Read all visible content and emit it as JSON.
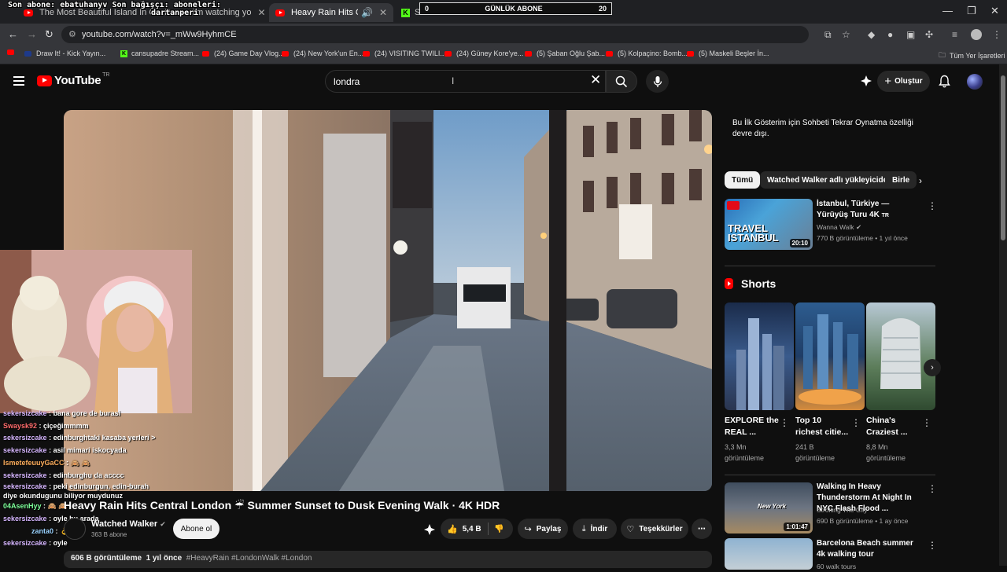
{
  "overlay": {
    "line1": "Son abone: ebatuhanyv Son bağışçı: aboneleri:",
    "line2": "dartanperi",
    "abone_left": "0",
    "abone_label": "GÜNLÜK ABONE",
    "abone_count": "20"
  },
  "tabs": [
    {
      "label": "The Most Beautiful Island In On"
    },
    {
      "label": "...Rosa - i'm watching yo"
    },
    {
      "label": "Heavy Rain Hits Central Lon"
    },
    {
      "label": "Stream - Kick Dashboard"
    }
  ],
  "browser": {
    "url": "youtube.com/watch?v=_mWw9HyhmCE",
    "bookmarks": [
      "Draw It! - Kick Yayın...",
      "cansupadre Stream...",
      "(24) Game Day Vlog...",
      "(24) New York'un En...",
      "(24) VISITING TWILI...",
      "(24) Güney Kore'ye...",
      "(5) Şaban Oğlu Şab...",
      "(5) Kolpaçino: Bomb...",
      "(5) Maskeli Beşler İn..."
    ],
    "all_bookmarks": "Tüm Yer İşaretleri"
  },
  "header": {
    "logo": "YouTube",
    "country": "TR",
    "search_value": "londra",
    "create_label": "Oluştur"
  },
  "video": {
    "title": "Heavy Rain Hits Central London ☔ Summer Sunset to Dusk Evening Walk · 4K HDR",
    "channel": "Watched Walker",
    "subs": "363 B abone",
    "subscribe": "Abone ol",
    "likes": "5,4 B",
    "share": "Paylaş",
    "download": "İndir",
    "thanks": "Teşekkürler",
    "views": "606 B görüntüleme",
    "age": "1 yıl önce",
    "tags": "#HeavyRain #LondonWalk #London"
  },
  "chat": [
    {
      "user": "sekersizcake",
      "msg": "bana gore de burasi"
    },
    {
      "user": "Swaysk92",
      "msg": "çiçeğimmmm"
    },
    {
      "user": "sekersizcake",
      "msg": "edinburghtaki kasaba yerleri >"
    },
    {
      "user": "sekersizcake",
      "msg": "asil mimari iskocyada"
    },
    {
      "user": "IsmetefeuuyGaCC",
      "msg": "🙈 🙈"
    },
    {
      "user": "sekersizcake",
      "msg": "edinburghu da acccc"
    },
    {
      "user": "sekersizcake",
      "msg": "peki edinburgun, edin-burah diye okundugunu biliyor muydunuz"
    },
    {
      "user": "04AsenHyy",
      "msg": "🙈 🙈"
    },
    {
      "user": "sekersizcake",
      "msg": "oyle bu arada"
    },
    {
      "user": "zanta0",
      "msg": "👌"
    },
    {
      "user": "sekersizcake",
      "msg": "oyle"
    }
  ],
  "sidebar": {
    "notice": "Bu İlk Gösterim için Sohbeti Tekrar Oynatma özelliği devre dışı.",
    "chips": [
      "Tümü",
      "Watched Walker adlı yükleyiciden",
      "Birle"
    ],
    "rec1": {
      "title": "İstanbul, Türkiye — Yürüyüş Turu 4K",
      "country": "TR",
      "channel": "Wanna Walk",
      "meta": "770 B görüntüleme • 1 yıl önce",
      "duration": "20:10",
      "thumb_text1": "TRAVEL",
      "thumb_text2": "ISTANBUL"
    },
    "shorts_label": "Shorts",
    "shorts": [
      {
        "title": "EXPLORE the REAL ...",
        "views": "3,3 Mn görüntüleme"
      },
      {
        "title": "Top 10 richest citie...",
        "views": "241 B görüntüleme"
      },
      {
        "title": "China's Craziest ...",
        "views": "8,8 Mn görüntüleme"
      }
    ],
    "rec2": {
      "title": "Walking In Heavy Thunderstorm At Night In NYC Flash Flood ...",
      "channel": "Strolling The City",
      "meta": "690 B görüntüleme • 1 ay önce",
      "duration": "1:01:47",
      "thumb_text": "New York"
    },
    "rec3": {
      "title": "Barcelona Beach summer 4k walking tour",
      "channel": "60 walk tours"
    }
  }
}
